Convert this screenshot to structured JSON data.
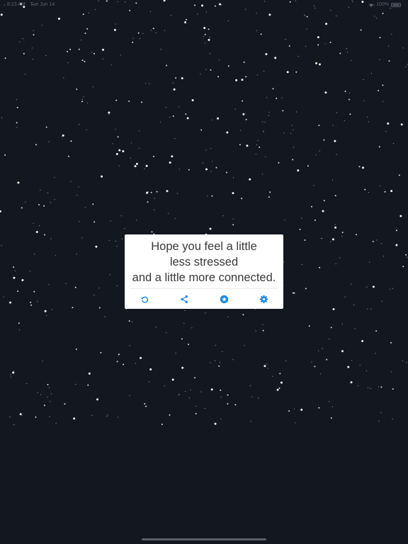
{
  "status_bar": {
    "time": "8:23 AM",
    "date": "Tue Jun 14",
    "battery": "100%"
  },
  "card": {
    "message_lines": [
      "Hope you feel a little",
      "less stressed",
      "and a little more connected."
    ]
  },
  "toolbar": {
    "icons": [
      "refresh-icon",
      "share-icon",
      "favorite-star-icon",
      "settings-gear-icon"
    ]
  },
  "colors": {
    "background": "#121720",
    "card": "#ffffff",
    "text": "#3a3a3a",
    "accent": "#1e88e5",
    "star": "#ffffff"
  }
}
